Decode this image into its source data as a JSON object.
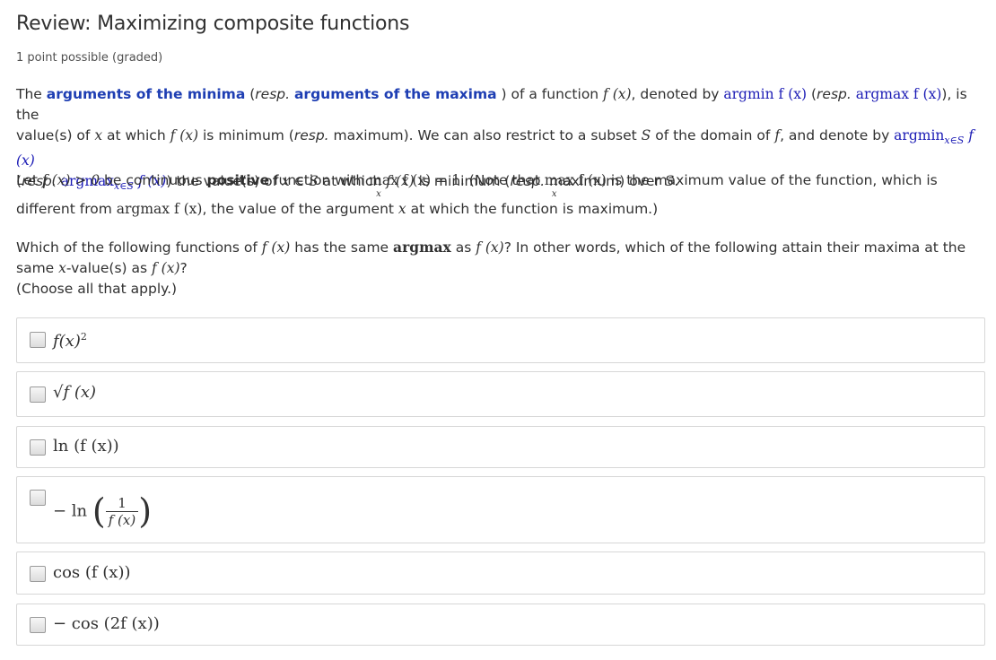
{
  "page": {
    "title": "Review: Maximizing composite functions",
    "points": "1 point possible (graded)"
  },
  "p1": {
    "t1": "The ",
    "b1": "arguments of the minima",
    "t2": " (",
    "resp1": "resp.",
    "t3": " ",
    "b2": "arguments of the maxima",
    "t4": " ) of a function ",
    "fx": "f (x)",
    "t5": ", denoted by ",
    "argminf": "argmin f (x)",
    "t6": " (",
    "resp2": "resp.",
    "t7": " ",
    "argmaxf": "argmax f (x)",
    "t8": "), is the",
    "l2a": "value(s) of ",
    "x1": "x",
    "l2b": " at which ",
    "fx2": "f (x)",
    "l2c": " is minimum (",
    "resp3": "resp.",
    "l2d": " maximum). We can also restrict to a subset ",
    "S1": "S",
    "l2e": " of the domain of ",
    "f1": "f",
    "l2f": ", and denote by ",
    "argmin2": "argmin",
    "sub1": "x∈S",
    "fx3": " f (x)",
    "l3a": "(",
    "resp4": "resp.",
    "l3b": " ",
    "argmax2": "argmax",
    "sub2": "x∈S",
    "fx4": " f (x)",
    "l3c": ") the value(s) of ",
    "xinS": "x ∈ S",
    "l3d": " at which ",
    "fx5": "f (x)",
    "l3e": " is minimum (",
    "resp5": "resp.",
    "l3f": " maximum) over ",
    "S2": "S",
    "l3g": "."
  },
  "p2": {
    "a": "Let ",
    "fx": "f (x) > 0",
    "b": " be continuous ",
    "pos": "positive",
    "c": " function with ",
    "maxf": "max f (x) = 1.",
    "maxsub": "x",
    "d": "  (Note that ",
    "maxf2": "max f (x)",
    "maxsub2": "x",
    "e": " is the maximum value of the function, which is",
    "f": "different from ",
    "argmaxf": "argmax f (x)",
    "g": ", the value of the argument ",
    "x": "x",
    "h": " at which the function is maximum.)"
  },
  "p3": {
    "a": "Which of the following functions of ",
    "fx": "f (x)",
    "b": " has the same ",
    "argmax": "argmax",
    "c": " as ",
    "fx2": "f (x)",
    "d": "? In other words, which of the following attain their maxima at the",
    "e": "same ",
    "x": "x",
    "f": "-value(s) as ",
    "fx3": "f (x)",
    "g": "?",
    "h": "(Choose all that apply.)"
  },
  "options": [
    {
      "label": "f(x)",
      "sup": "2"
    },
    {
      "label": "√f (x)"
    },
    {
      "label": "ln (f (x))"
    },
    {
      "pre": "− ln",
      "num": "1",
      "den": "f (x)"
    },
    {
      "label": "cos (f (x))"
    },
    {
      "label": "− cos (2f (x))"
    }
  ]
}
